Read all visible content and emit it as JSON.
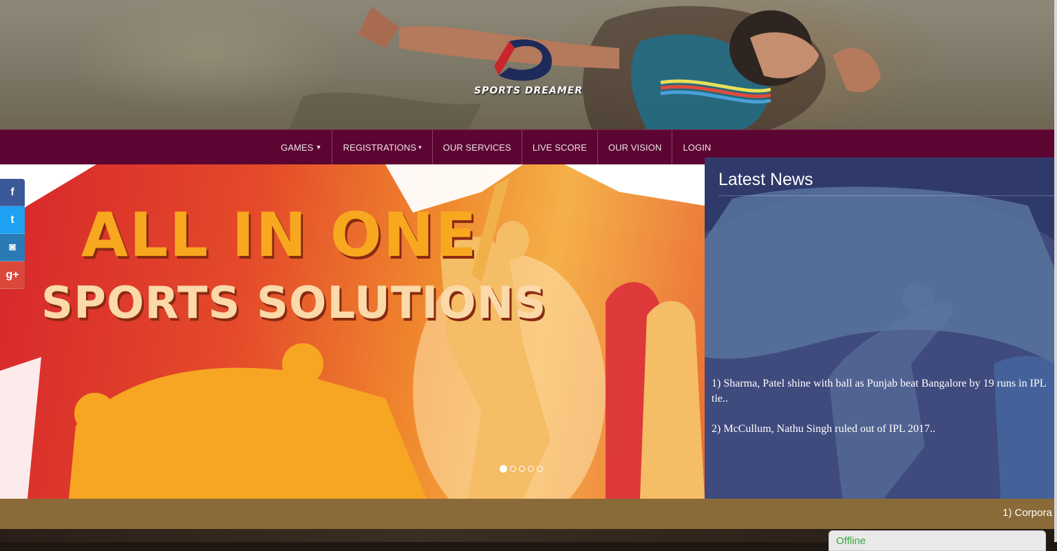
{
  "brand": {
    "logo_text": "SPORTS DREAMER"
  },
  "nav": {
    "items": [
      {
        "label": "GAMES",
        "caret": "chevron-down-icon"
      },
      {
        "label": "REGISTRATIONS",
        "caret": "caret-down-icon"
      },
      {
        "label": "OUR SERVICES"
      },
      {
        "label": "LIVE SCORE"
      },
      {
        "label": "OUR VISION"
      },
      {
        "label": "LOGIN"
      }
    ]
  },
  "hero": {
    "line1": "ALL IN ONE",
    "line2": "SPORTS SOLUTIONS",
    "slide_count": 5,
    "active_slide": 1
  },
  "social": [
    {
      "name": "facebook-icon",
      "glyph": "f",
      "color": "#3b5998"
    },
    {
      "name": "twitter-icon",
      "glyph": "t",
      "color": "#1da1f2"
    },
    {
      "name": "instagram-icon",
      "glyph": "◙",
      "color": "#2a7bb5"
    },
    {
      "name": "google-plus-icon",
      "glyph": "g+",
      "color": "#d9483b"
    }
  ],
  "news": {
    "title": "Latest News",
    "items": [
      "1) Sharma, Patel shine with ball as Punjab beat Bangalore by 19 runs in IPL tie..",
      "2) McCullum, Nathu Singh ruled out of IPL 2017.."
    ]
  },
  "ticker": {
    "text": "1) Corpora"
  },
  "chat": {
    "status": "Offline"
  },
  "colors": {
    "nav_bg": "#5c0532",
    "news_bg": "#3f4a7d",
    "ticker_bg": "#8a6a38",
    "hero_text": "#f8a81f"
  }
}
